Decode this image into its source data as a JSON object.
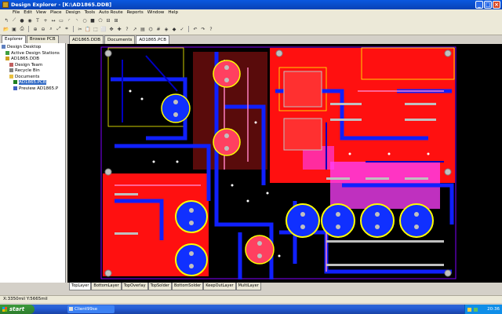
{
  "window": {
    "title": "Design Explorer - [K:\\AD1865.DDB]",
    "controls": {
      "minimize": "_",
      "maximize": "□",
      "close": "×"
    }
  },
  "menu": [
    "File",
    "Edit",
    "View",
    "Place",
    "Design",
    "Tools",
    "Auto Route",
    "Reports",
    "Window",
    "Help"
  ],
  "panel": {
    "tabs": [
      "Explorer",
      "Browse PCB"
    ],
    "tree": [
      {
        "label": "Design Desktop",
        "icon": "desktop-icon",
        "indent": 0
      },
      {
        "label": "Active Design Stations",
        "icon": "stations-icon",
        "indent": 1
      },
      {
        "label": "AD1865.DDB",
        "icon": "database-icon",
        "indent": 1
      },
      {
        "label": "Design Team",
        "icon": "team-icon",
        "indent": 2
      },
      {
        "label": "Recycle Bin",
        "icon": "recycle-bin-icon",
        "indent": 2
      },
      {
        "label": "Documents",
        "icon": "folder-icon",
        "indent": 2
      },
      {
        "label": "AD1865.PCB",
        "icon": "pcb-document-icon",
        "indent": 3,
        "selected": true
      },
      {
        "label": "Preview AD1865.P",
        "icon": "preview-icon",
        "indent": 3
      }
    ]
  },
  "doc_tabs": [
    "AD1865.DDB",
    "Documents",
    "AD1865.PCB"
  ],
  "layer_tabs": [
    "TopLayer",
    "BottomLayer",
    "TopOverlay",
    "TopSolder",
    "BottomSolder",
    "KeepOutLayer",
    "MultiLayer"
  ],
  "status": {
    "coords": "X:3350mil Y:5665mil"
  },
  "taskbar": {
    "start_label": "start",
    "task_label": "Client99se",
    "clock": "20:36"
  },
  "colors": {
    "top_layer": "#ff0000",
    "bottom_layer": "#0000ff",
    "overlay": "#ffff00",
    "pads": "#c0c0c0",
    "solder": "#ff00ff"
  }
}
